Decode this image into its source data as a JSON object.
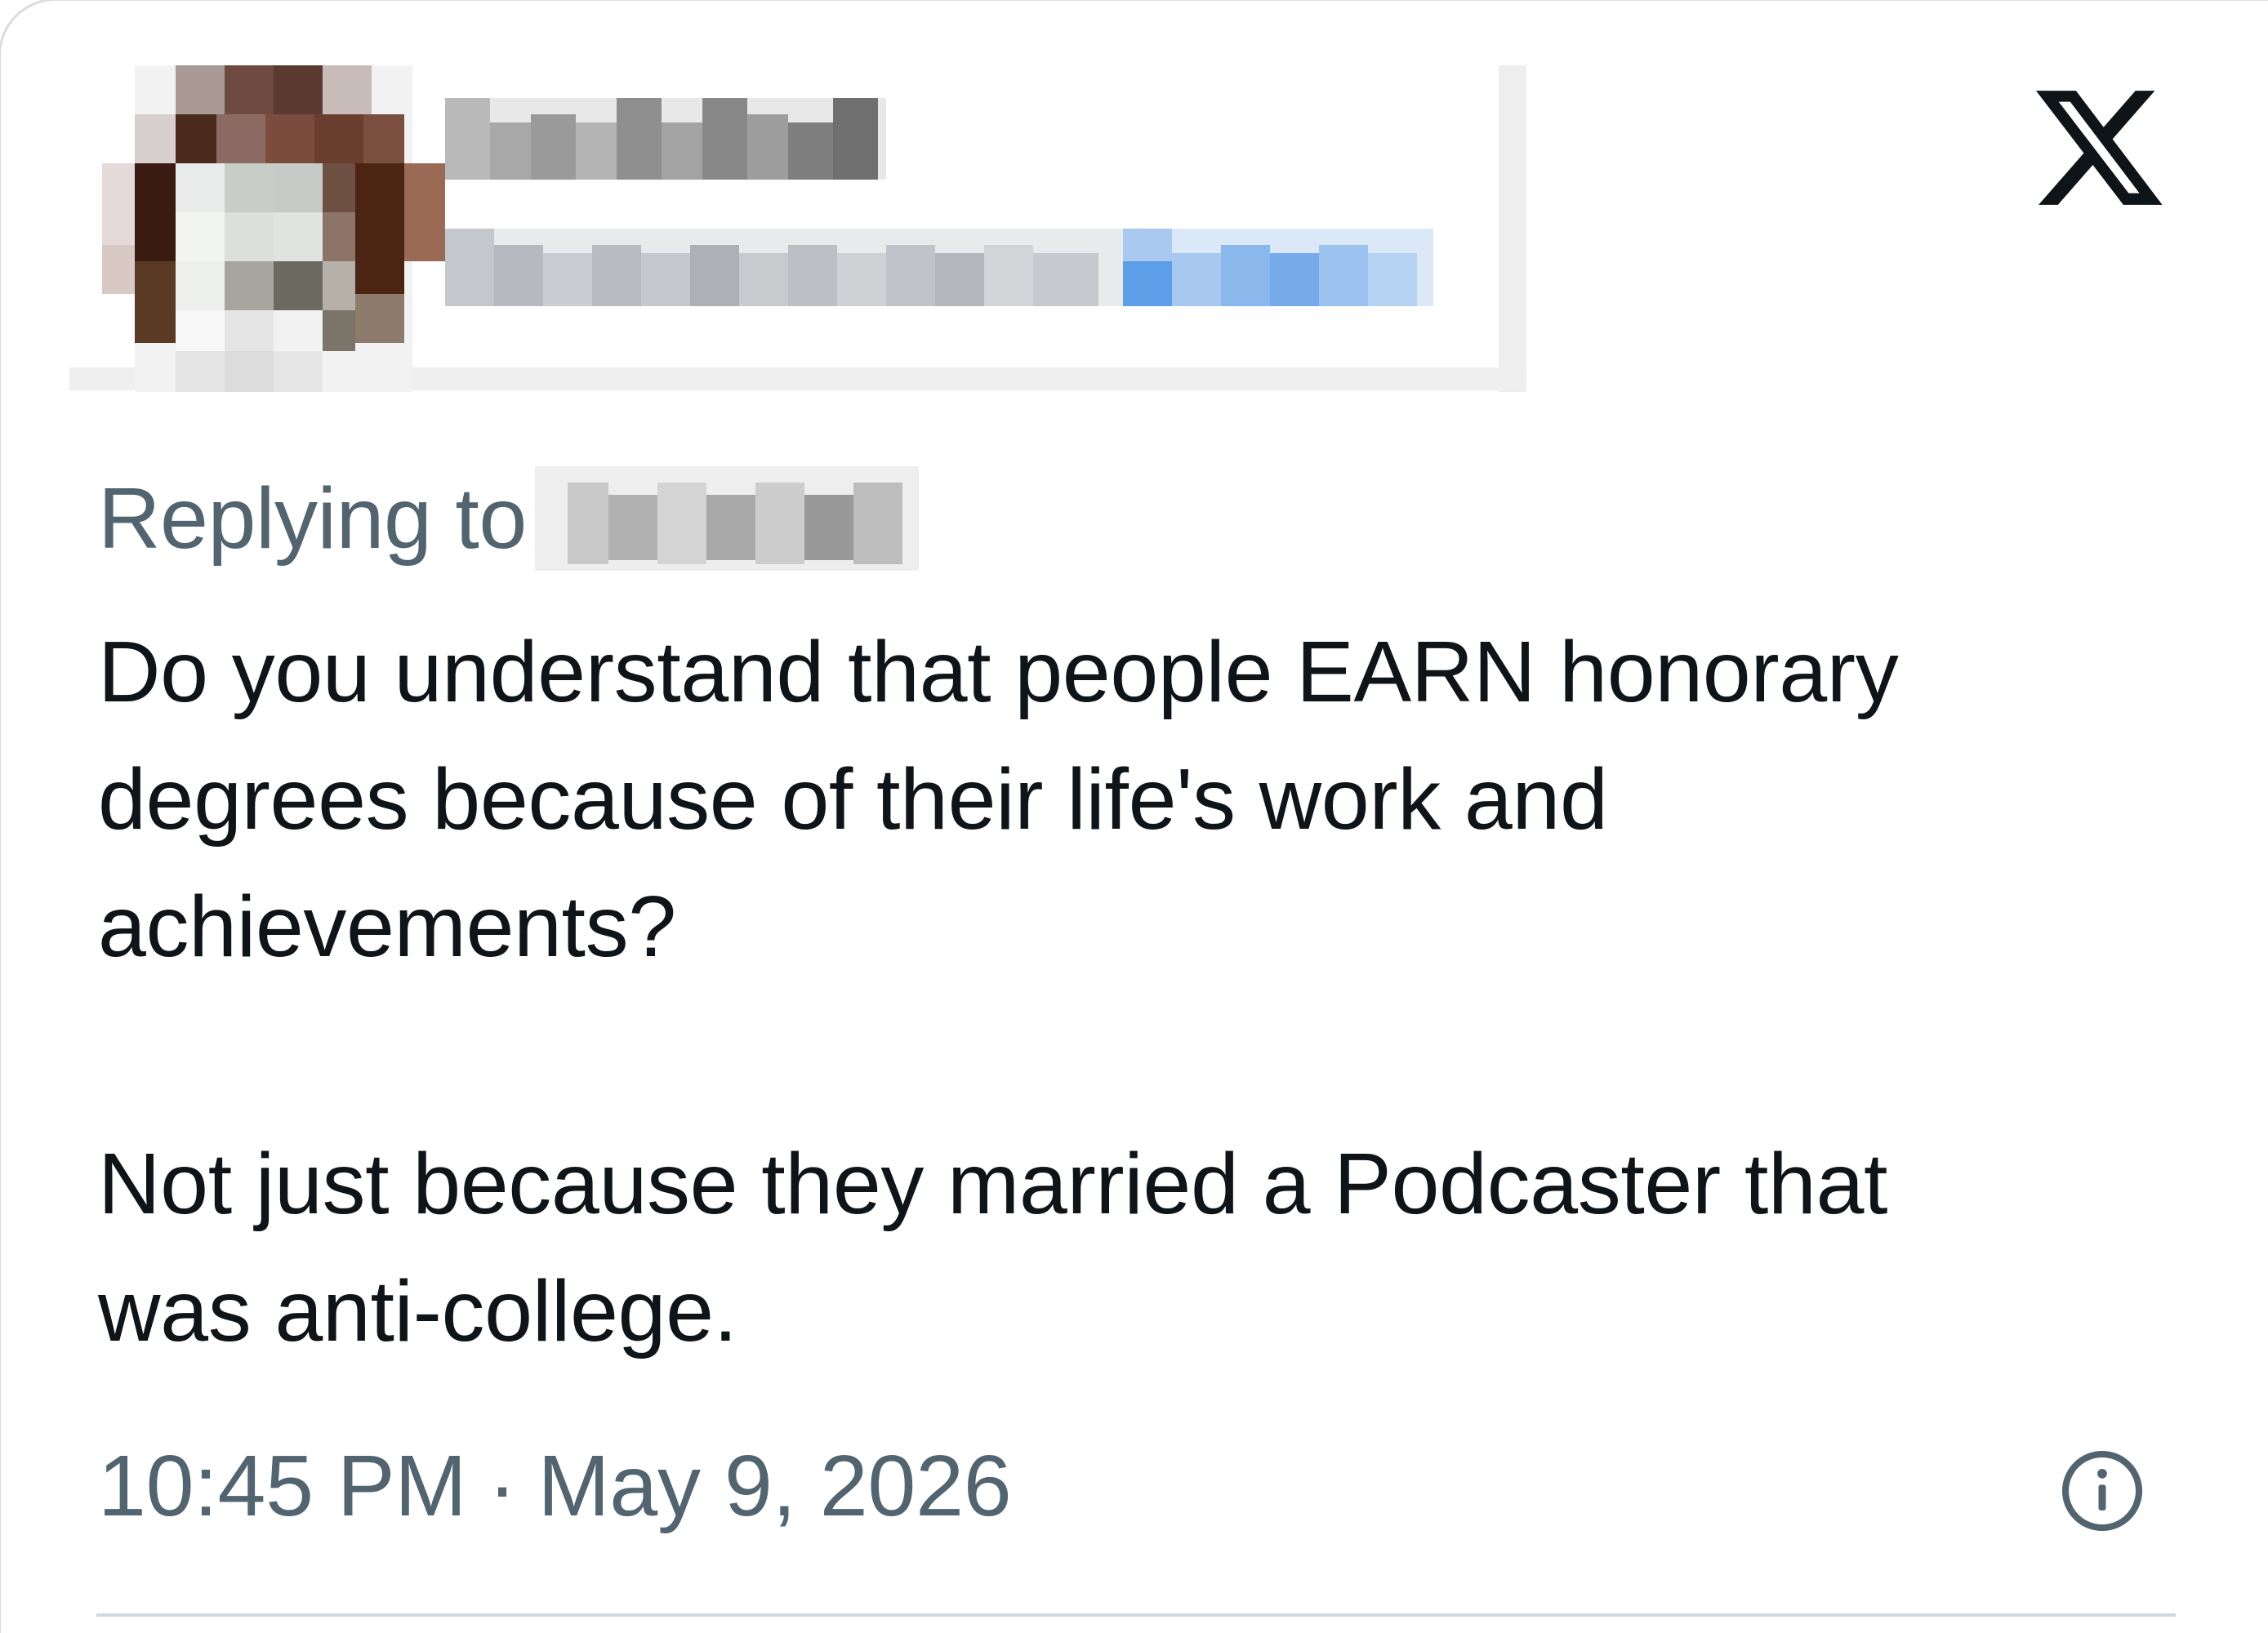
{
  "tweet": {
    "reply_prefix": "Replying to",
    "body_paragraphs": [
      "Do you understand that people EARN honorary",
      "degrees because of their life's work and",
      "achievements?",
      "Not just because they married a Podcaster that",
      "was anti-college."
    ],
    "time": "10:45 PM",
    "separator": "·",
    "date": "May 9, 2026"
  },
  "icons": {
    "brand": "x-logo-icon",
    "info": "info-icon"
  },
  "colors": {
    "text_primary": "#0f1419",
    "text_secondary": "#536471",
    "divider": "#cfd9de",
    "redacted_link_blue": "#8ab8ec"
  }
}
